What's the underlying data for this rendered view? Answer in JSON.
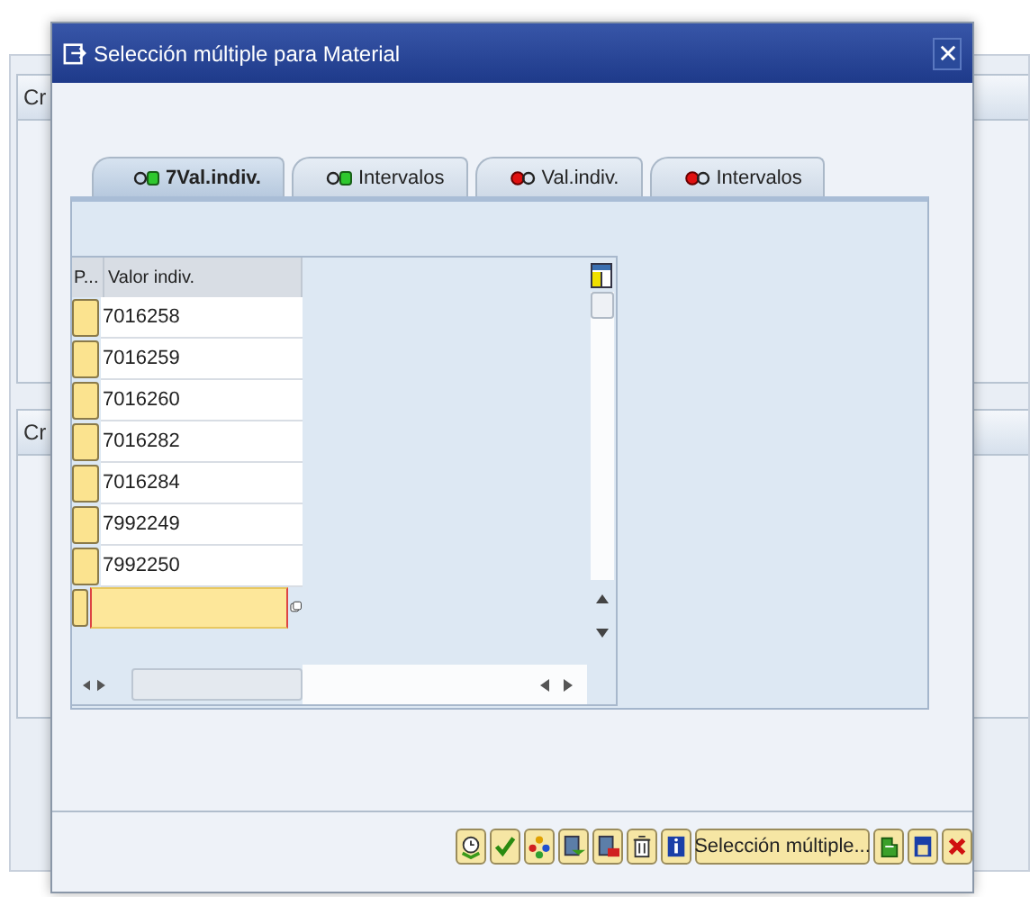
{
  "background_window": {
    "groups": [
      {
        "title": "Cr"
      },
      {
        "title": "Cr"
      }
    ]
  },
  "dialog": {
    "title": "Selección múltiple para Material",
    "tabs": [
      {
        "label": "7Val.indiv.",
        "kind": "include",
        "selected": true
      },
      {
        "label": "Intervalos",
        "kind": "include",
        "selected": false
      },
      {
        "label": "Val.indiv.",
        "kind": "exclude",
        "selected": false
      },
      {
        "label": "Intervalos",
        "kind": "exclude",
        "selected": false
      }
    ],
    "table": {
      "columns": [
        "P...",
        "Valor indiv."
      ],
      "rows": [
        "7016258",
        "7016259",
        "7016260",
        "7016282",
        "7016284",
        "7992249",
        "7992250"
      ]
    },
    "multi_select_button": "Selección múltiple..."
  }
}
